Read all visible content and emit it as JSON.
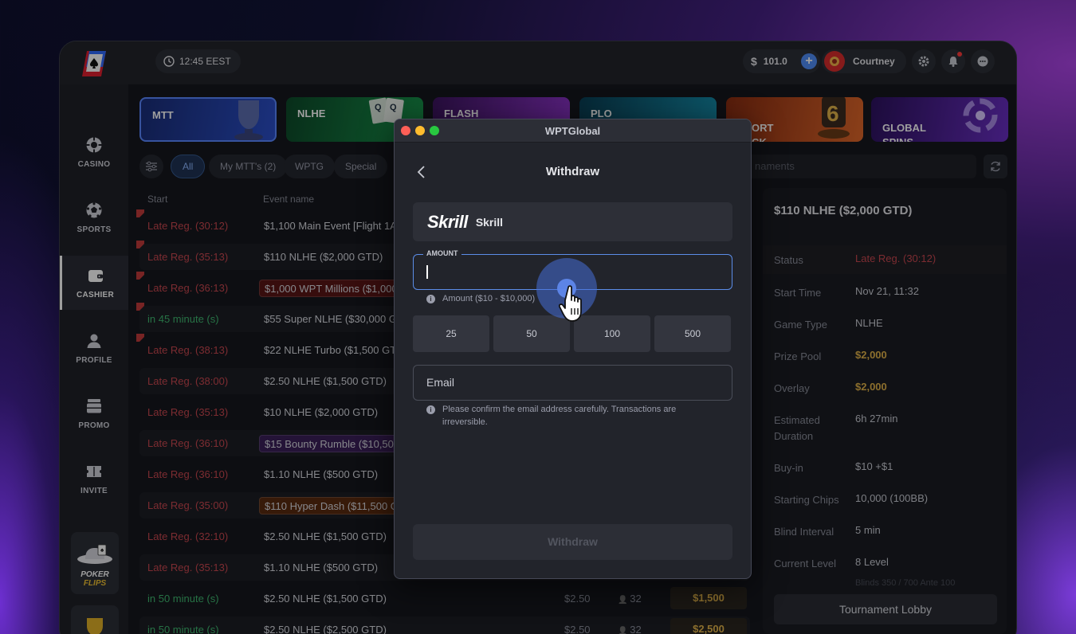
{
  "topbar": {
    "clock": "12:45 EEST",
    "balance": "101.0",
    "currency_icon": "dollar-icon",
    "username": "Courtney"
  },
  "sidebar": {
    "items": [
      {
        "label": "CASINO",
        "icon": "casino-chip-icon"
      },
      {
        "label": "SPORTS",
        "icon": "soccer-ball-icon"
      },
      {
        "label": "CASHIER",
        "icon": "wallet-icon",
        "active": true
      },
      {
        "label": "PROFILE",
        "icon": "user-icon"
      },
      {
        "label": "PROMO",
        "icon": "promo-icon"
      },
      {
        "label": "INVITE",
        "icon": "ticket-icon"
      }
    ],
    "promo_tile": {
      "line1": "POKER",
      "line2": "FLIPS"
    }
  },
  "banners": [
    {
      "label": "MTT",
      "color": "#1e3fa8"
    },
    {
      "label": "NLHE",
      "color": "#12703a"
    },
    {
      "label": "FLASH",
      "color": "#6a2396"
    },
    {
      "label": "PLO",
      "color": "#0f6a82"
    },
    {
      "label": "SHORT\nDECK",
      "color": "#a8461a"
    },
    {
      "label": "GLOBAL\nSPINS",
      "color": "#4f2090"
    }
  ],
  "filters": [
    {
      "label": "All",
      "active": true
    },
    {
      "label": "My MTT's (2)"
    },
    {
      "label": "WPTG"
    },
    {
      "label": "Special"
    }
  ],
  "search": {
    "placeholder": "naments"
  },
  "list": {
    "col_start": "Start",
    "col_event": "Event name",
    "rows": [
      {
        "start": "Late Reg.  (30:12)",
        "name": "$1,100 Main Event [Flight 1A]",
        "flag": true
      },
      {
        "start": "Late Reg.  (35:13)",
        "name": "$110 NLHE ($2,000 GTD)",
        "flag": true
      },
      {
        "start": "Late Reg.  (36:13)",
        "name": "$1,000 WPT Millions ($1,000,000",
        "flag": true,
        "highlight": "#5a1616"
      },
      {
        "start": "in 45 minute (s)",
        "name": "$55 Super NLHE ($30,000 GTD)",
        "flag": true,
        "green": true
      },
      {
        "start": "Late Reg.  (38:13)",
        "name": "$22 NLHE Turbo ($1,500 GTD)",
        "flag": true
      },
      {
        "start": "Late Reg.  (38:00)",
        "name": "$2.50 NLHE ($1,500 GTD)"
      },
      {
        "start": "Late Reg.  (35:13)",
        "name": "$10 NLHE ($2,000 GTD)"
      },
      {
        "start": "Late Reg.  (36:10)",
        "name": "$15 Bounty Rumble ($10,500",
        "highlight": "#3a1f5a"
      },
      {
        "start": "Late Reg.  (36:10)",
        "name": "$1.10 NLHE ($500 GTD)"
      },
      {
        "start": "Late Reg.  (35:00)",
        "name": "$110 Hyper Dash ($11,500 GTD",
        "highlight": "#5a2a10"
      },
      {
        "start": "Late Reg.  (32:10)",
        "name": "$2.50 NLHE ($1,500 GTD)"
      },
      {
        "start": "Late Reg.  (35:13)",
        "name": "$1.10 NLHE ($500 GTD)"
      },
      {
        "start": "in 50 minute (s)",
        "name": "$2.50 NLHE ($1,500 GTD)",
        "green": true,
        "buyin": "$2.50",
        "players": "32",
        "prize": "$1,500"
      },
      {
        "start": "in 50 minute (s)",
        "name": "$2.50 NLHE ($2,500 GTD)",
        "green": true,
        "buyin": "$2.50",
        "players": "32",
        "prize": "$2,500"
      }
    ]
  },
  "detail": {
    "title": "$110 NLHE ($2,000 GTD)",
    "rows": [
      {
        "k": "Status",
        "v": "Late Reg. (30:12)",
        "style": "red"
      },
      {
        "k": "Start Time",
        "v": "Nov 21, 11:32"
      },
      {
        "k": "Game Type",
        "v": "NLHE"
      },
      {
        "k": "Prize Pool",
        "v": "$2,000",
        "style": "gold"
      },
      {
        "k": "Overlay",
        "v": "$2,000",
        "style": "gold"
      },
      {
        "k": "Estimated\nDuration",
        "v": "6h 27min"
      },
      {
        "k": "Buy-in",
        "v": "$10 +$1"
      },
      {
        "k": "Starting Chips",
        "v": "10,000 (100BB)"
      },
      {
        "k": "Blind Interval",
        "v": "5 min"
      },
      {
        "k": "Current Level",
        "v": "8 Level"
      }
    ],
    "blinds_sub": "Blinds 350 / 700 Ante 100",
    "lobby_button": "Tournament Lobby"
  },
  "dialog": {
    "window_title": "WPTGlobal",
    "title": "Withdraw",
    "method_logo": "Skrill",
    "method_name": "Skrill",
    "amount_label": "AMOUNT",
    "amount_value": "",
    "amount_hint": "Amount ($10 - $10,000)",
    "quick_amounts": [
      "25",
      "50",
      "100",
      "500"
    ],
    "email_placeholder": "Email",
    "email_hint": "Please confirm the email address carefully. Transactions are irreversible.",
    "submit_label": "Withdraw"
  }
}
